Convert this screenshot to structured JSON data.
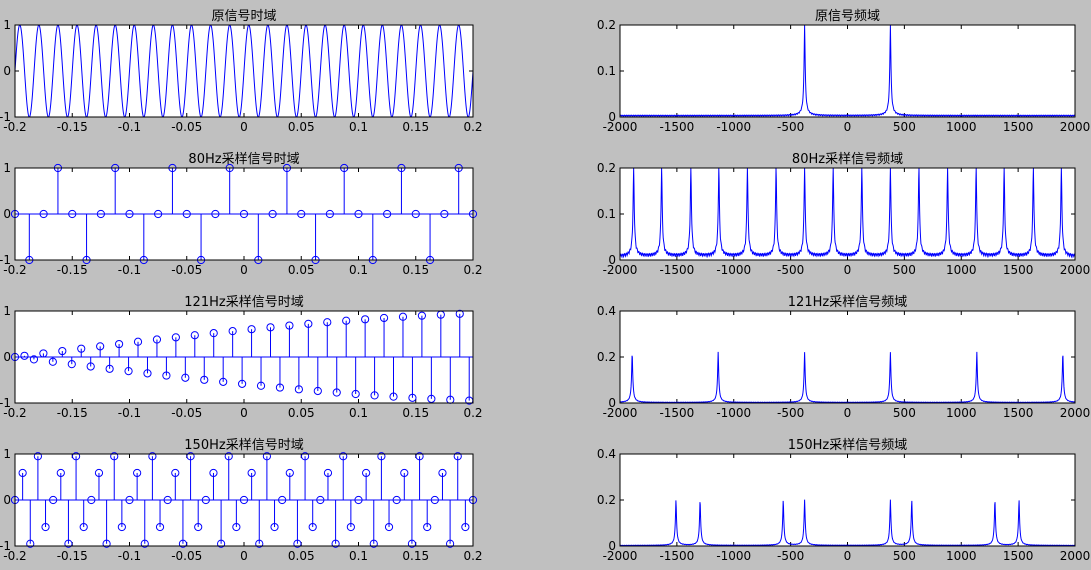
{
  "figure": {
    "background": "#c0c0c0",
    "line_color": "#0000ff"
  },
  "chart_data": [
    {
      "id": "orig_time",
      "type": "line",
      "title": "原信号时域",
      "xlim": [
        -0.2,
        0.2
      ],
      "ylim": [
        -1,
        1
      ],
      "xticks": [
        -0.2,
        -0.15,
        -0.1,
        -0.05,
        0,
        0.05,
        0.1,
        0.15,
        0.2
      ],
      "xtick_labels": [
        "-0.2",
        "-0.15",
        "-0.1",
        "-0.05",
        "0",
        "0.05",
        "0.1",
        "0.15",
        "0.2"
      ],
      "yticks": [
        -1,
        0,
        1
      ],
      "ytick_labels": [
        "-1",
        "0",
        "1"
      ],
      "signal": {
        "kind": "sine",
        "freq_hz": 60,
        "amplitude": 1,
        "n_points": 2400
      }
    },
    {
      "id": "orig_freq",
      "type": "line",
      "title": "原信号频域",
      "xlim": [
        -2000,
        2000
      ],
      "ylim": [
        0,
        0.2
      ],
      "xticks": [
        -2000,
        -1500,
        -1000,
        -500,
        0,
        500,
        1000,
        1500,
        2000
      ],
      "xtick_labels": [
        "-2000",
        "-1500",
        "-1000",
        "-500",
        "0",
        "500",
        "1000",
        "1500",
        "2000"
      ],
      "yticks": [
        0,
        0.1,
        0.2
      ],
      "ytick_labels": [
        "0",
        "0.1",
        "0.2"
      ],
      "spectrum": {
        "peaks": [
          -377,
          377
        ],
        "peak_height": 0.2,
        "ripple": 0.004,
        "n_points": 1400
      }
    },
    {
      "id": "s80_time",
      "type": "stem",
      "title": "80Hz采样信号时域",
      "xlim": [
        -0.2,
        0.2
      ],
      "ylim": [
        -1,
        1
      ],
      "xticks": [
        -0.2,
        -0.15,
        -0.1,
        -0.05,
        0,
        0.05,
        0.1,
        0.15,
        0.2
      ],
      "xtick_labels": [
        "-0.2",
        "-0.15",
        "-0.1",
        "-0.05",
        "0",
        "0.05",
        "0.1",
        "0.15",
        "0.2"
      ],
      "yticks": [
        -1,
        0,
        1
      ],
      "ytick_labels": [
        "-1",
        "0",
        "1"
      ],
      "stem": {
        "fs_hz": 80,
        "freq_hz": 60,
        "t_start": -0.2,
        "t_end": 0.2
      }
    },
    {
      "id": "s80_freq",
      "type": "line",
      "title": "80Hz采样信号频域",
      "xlim": [
        -2000,
        2000
      ],
      "ylim": [
        0,
        0.2
      ],
      "xticks": [
        -2000,
        -1500,
        -1000,
        -500,
        0,
        500,
        1000,
        1500,
        2000
      ],
      "xtick_labels": [
        "-2000",
        "-1500",
        "-1000",
        "-500",
        "0",
        "500",
        "1000",
        "1500",
        "2000"
      ],
      "yticks": [
        0,
        0.1,
        0.2
      ],
      "ytick_labels": [
        "0",
        "0.1",
        "0.2"
      ],
      "spectrum": {
        "peaks": [
          -1880,
          -1634,
          -1377,
          -1131,
          -880,
          -628,
          -377,
          -126,
          126,
          377,
          628,
          880,
          1131,
          1377,
          1634,
          1880
        ],
        "peak_height": 0.2,
        "ripple": 0.01,
        "n_points": 1400
      }
    },
    {
      "id": "s121_time",
      "type": "stem",
      "title": "121Hz采样信号时域",
      "xlim": [
        -0.2,
        0.2
      ],
      "ylim": [
        -1,
        1
      ],
      "xticks": [
        -0.2,
        -0.15,
        -0.1,
        -0.05,
        0,
        0.05,
        0.1,
        0.15,
        0.2
      ],
      "xtick_labels": [
        "-0.2",
        "-0.15",
        "-0.1",
        "-0.05",
        "0",
        "0.05",
        "0.1",
        "0.15",
        "0.2"
      ],
      "yticks": [
        -1,
        0,
        1
      ],
      "ytick_labels": [
        "-1",
        "0",
        "1"
      ],
      "stem": {
        "fs_hz": 121,
        "freq_hz": 60,
        "t_start": -0.2,
        "t_end": 0.2
      }
    },
    {
      "id": "s121_freq",
      "type": "line",
      "title": "121Hz采样信号频域",
      "xlim": [
        -2000,
        2000
      ],
      "ylim": [
        0,
        0.4
      ],
      "xticks": [
        -2000,
        -1500,
        -1000,
        -500,
        0,
        500,
        1000,
        1500,
        2000
      ],
      "xtick_labels": [
        "-2000",
        "-1500",
        "-1000",
        "-500",
        "0",
        "500",
        "1000",
        "1500",
        "2000"
      ],
      "yticks": [
        0,
        0.2,
        0.4
      ],
      "ytick_labels": [
        "0",
        "0.2",
        "0.4"
      ],
      "spectrum": {
        "peaks": [
          -1893,
          -1137,
          -377,
          377,
          1137,
          1893
        ],
        "peak_height": 0.22,
        "ripple": 0.003,
        "n_points": 1400
      }
    },
    {
      "id": "s150_time",
      "type": "stem",
      "title": "150Hz采样信号时域",
      "xlim": [
        -0.2,
        0.2
      ],
      "ylim": [
        -1,
        1
      ],
      "xticks": [
        -0.2,
        -0.15,
        -0.1,
        -0.05,
        0,
        0.05,
        0.1,
        0.15,
        0.2
      ],
      "xtick_labels": [
        "-0.2",
        "-0.15",
        "-0.1",
        "-0.05",
        "0",
        "0.05",
        "0.1",
        "0.15",
        "0.2"
      ],
      "yticks": [
        -1,
        0,
        1
      ],
      "ytick_labels": [
        "-1",
        "0",
        "1"
      ],
      "stem": {
        "fs_hz": 150,
        "freq_hz": 60,
        "t_start": -0.2,
        "t_end": 0.2
      }
    },
    {
      "id": "s150_freq",
      "type": "line",
      "title": "150Hz采样信号频域",
      "xlim": [
        -2000,
        2000
      ],
      "ylim": [
        0,
        0.4
      ],
      "xticks": [
        -2000,
        -1500,
        -1000,
        -500,
        0,
        500,
        1000,
        1500,
        2000
      ],
      "xtick_labels": [
        "-2000",
        "-1500",
        "-1000",
        "-500",
        "0",
        "500",
        "1000",
        "1500",
        "2000"
      ],
      "yticks": [
        0,
        0.2,
        0.4
      ],
      "ytick_labels": [
        "0",
        "0.2",
        "0.4"
      ],
      "spectrum": {
        "peaks": [
          -1508,
          -1296,
          -565,
          -377,
          377,
          565,
          1296,
          1508
        ],
        "peak_height": 0.2,
        "ripple": 0.003,
        "n_points": 1400
      }
    }
  ]
}
